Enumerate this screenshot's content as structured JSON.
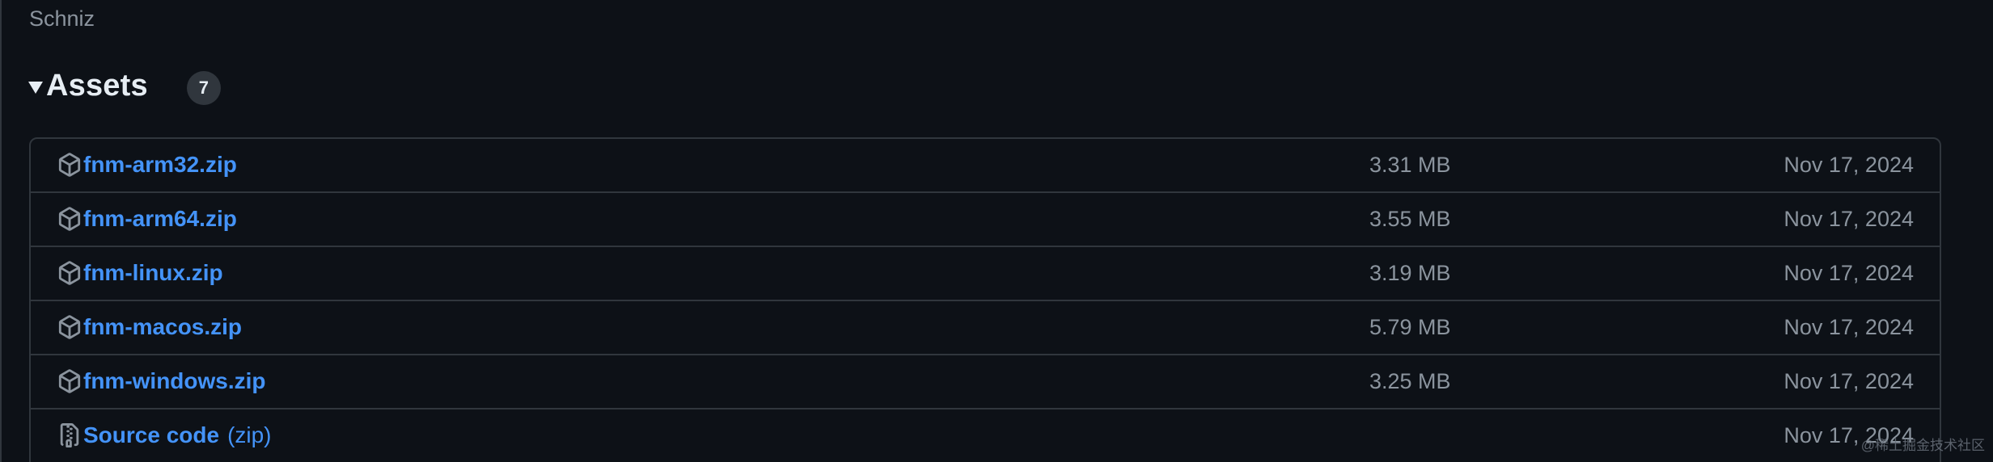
{
  "release": {
    "author": "Schniz"
  },
  "assets": {
    "title": "Assets",
    "count": "7",
    "items": [
      {
        "name": "fnm-arm32.zip",
        "suffix": "",
        "size": "3.31 MB",
        "date": "Nov 17, 2024",
        "icon": "package-icon"
      },
      {
        "name": "fnm-arm64.zip",
        "suffix": "",
        "size": "3.55 MB",
        "date": "Nov 17, 2024",
        "icon": "package-icon"
      },
      {
        "name": "fnm-linux.zip",
        "suffix": "",
        "size": "3.19 MB",
        "date": "Nov 17, 2024",
        "icon": "package-icon"
      },
      {
        "name": "fnm-macos.zip",
        "suffix": "",
        "size": "5.79 MB",
        "date": "Nov 17, 2024",
        "icon": "package-icon"
      },
      {
        "name": "fnm-windows.zip",
        "suffix": "",
        "size": "3.25 MB",
        "date": "Nov 17, 2024",
        "icon": "package-icon"
      },
      {
        "name": "Source code",
        "suffix": "(zip)",
        "size": "",
        "date": "Nov 17, 2024",
        "icon": "file-zip-icon"
      }
    ]
  },
  "watermark": "@稀土掘金技术社区",
  "colors": {
    "background": "#0d1117",
    "link": "#4493f8",
    "muted": "#8b949e",
    "border": "#30363d"
  }
}
